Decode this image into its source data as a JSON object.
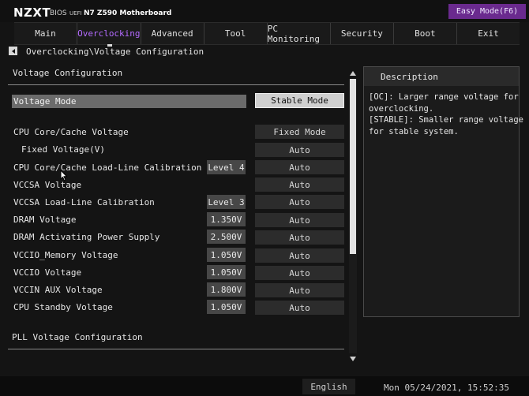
{
  "header": {
    "logo": "NZXT",
    "bios": "BIOS",
    "uefi": "UEFI",
    "board": "N7 Z590 Motherboard",
    "easy_mode": "Easy Mode(F6)"
  },
  "tabs": [
    {
      "label": "Main"
    },
    {
      "label": "Overclocking",
      "active": true
    },
    {
      "label": "Advanced"
    },
    {
      "label": "Tool"
    },
    {
      "label": "PC Monitoring"
    },
    {
      "label": "Security"
    },
    {
      "label": "Boot"
    },
    {
      "label": "Exit"
    }
  ],
  "breadcrumb": "Overclocking\\Voltage Configuration",
  "main": {
    "section_title": "Voltage Configuration",
    "voltage_mode": {
      "label": "Voltage Mode",
      "value": "Stable Mode"
    },
    "rows": [
      {
        "label": "CPU Core/Cache Voltage",
        "value": "",
        "option": "Fixed Mode"
      },
      {
        "label": "Fixed Voltage(V)",
        "value": "",
        "option": "Auto"
      },
      {
        "label": "CPU Core/Cache Load-Line Calibration",
        "value": "Level 4",
        "option": "Auto"
      },
      {
        "label": "VCCSA Voltage",
        "value": "",
        "option": "Auto"
      },
      {
        "label": "VCCSA Load-Line Calibration",
        "value": "Level 3",
        "option": "Auto"
      },
      {
        "label": "DRAM Voltage",
        "value": "1.350V",
        "option": "Auto"
      },
      {
        "label": "DRAM Activating Power Supply",
        "value": "2.500V",
        "option": "Auto"
      },
      {
        "label": "VCCIO_Memory Voltage",
        "value": "1.050V",
        "option": "Auto"
      },
      {
        "label": "VCCIO Voltage",
        "value": "1.050V",
        "option": "Auto"
      },
      {
        "label": "VCCIN AUX Voltage",
        "value": "1.800V",
        "option": "Auto"
      },
      {
        "label": "CPU Standby Voltage",
        "value": "1.050V",
        "option": "Auto"
      }
    ],
    "pll_section": "PLL Voltage Configuration"
  },
  "description": {
    "title": "Description",
    "lines": [
      "[OC]: Larger range voltage for",
      "overclocking.",
      "[STABLE]: Smaller range voltage",
      "for stable system."
    ]
  },
  "footer": {
    "language": "English",
    "datetime": "Mon 05/24/2021, 15:52:35"
  },
  "colors": {
    "accent_purple": "#6a2a8e",
    "active_tab_text": "#b46bff",
    "highlight_row": "#6b6b6b",
    "background": "#141414"
  }
}
